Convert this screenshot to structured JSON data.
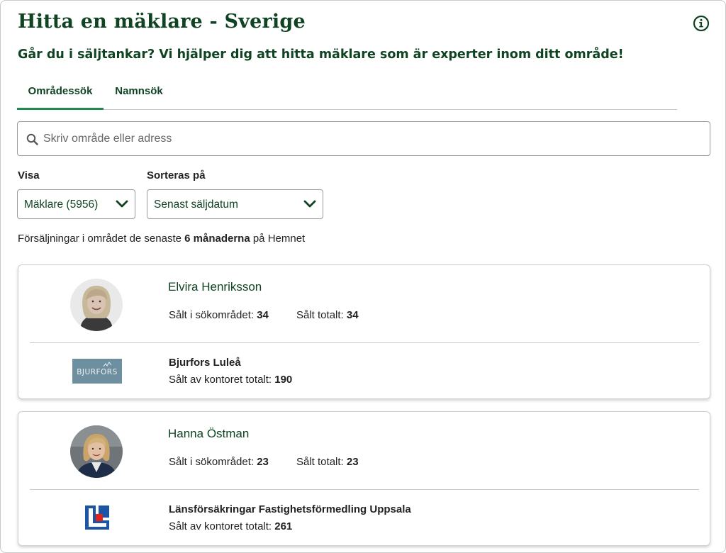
{
  "header": {
    "title": "Hitta en mäklare - Sverige",
    "subtitle": "Går du i säljtankar? Vi hjälper dig att hitta mäklare som är experter inom ditt område!",
    "info_icon": "info-circle-icon"
  },
  "tabs": [
    {
      "label": "Områdessök",
      "active": true
    },
    {
      "label": "Namnsök",
      "active": false
    }
  ],
  "search": {
    "placeholder": "Skriv område eller adress",
    "value": "",
    "icon": "search-icon"
  },
  "filters": {
    "visa_label": "Visa",
    "visa_value": "Mäklare (5956)",
    "sort_label": "Sorteras på",
    "sort_value": "Senast säljdatum"
  },
  "info_line": {
    "prefix": "Försäljningar i området de senaste ",
    "highlight": "6 månaderna",
    "suffix": " på Hemnet"
  },
  "agents": [
    {
      "name": "Elvira Henriksson",
      "sold_area_label": "Sålt i sökområdet: ",
      "sold_area_value": "34",
      "sold_total_label": "Sålt totalt: ",
      "sold_total_value": "34",
      "office_name": "Bjurfors Luleå",
      "office_total_label": "Sålt av kontoret totalt: ",
      "office_total_value": "190",
      "office_logo_text": "BJURFORS"
    },
    {
      "name": "Hanna Östman",
      "sold_area_label": "Sålt i sökområdet: ",
      "sold_area_value": "23",
      "sold_total_label": "Sålt totalt: ",
      "sold_total_value": "23",
      "office_name": "Länsförsäkringar Fastighetsförmedling Uppsala",
      "office_total_label": "Sålt av kontoret totalt: ",
      "office_total_value": "261"
    }
  ],
  "colors": {
    "brand_green": "#0f4322",
    "tab_underline": "#1f8a4c",
    "bjurfors_blue": "#6e8fa0",
    "lf_blue": "#1d55a6",
    "lf_red": "#e2231a"
  }
}
